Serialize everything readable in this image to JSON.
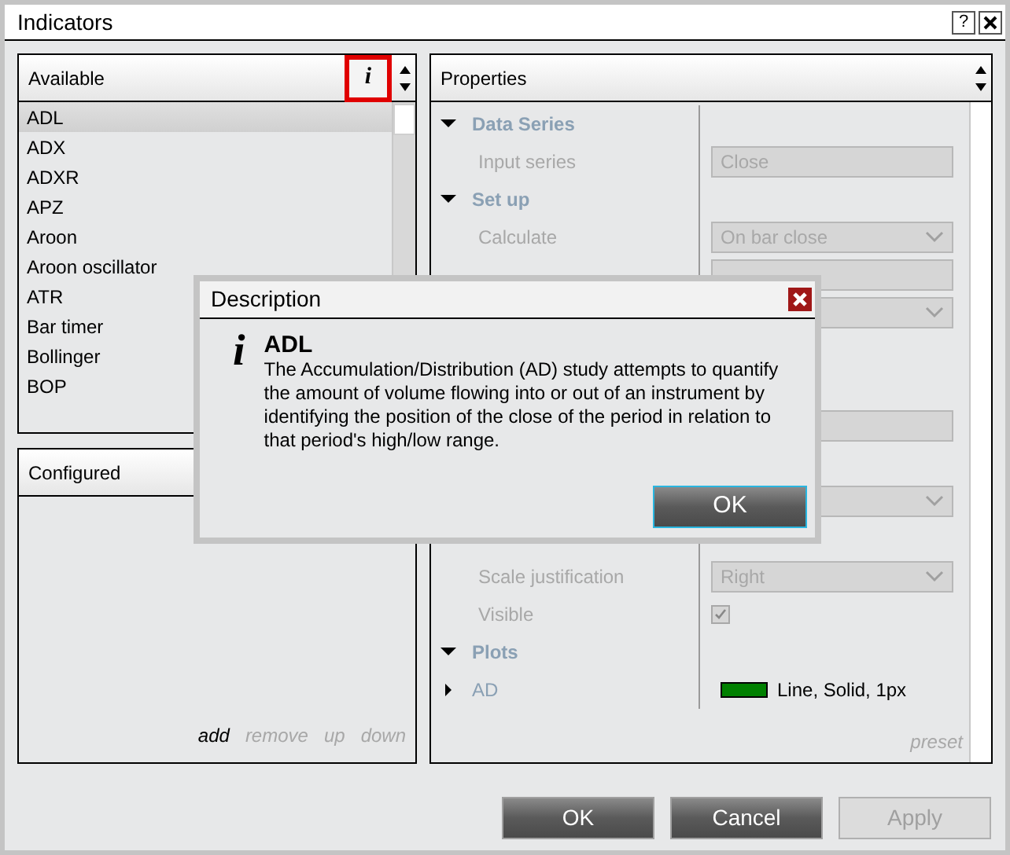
{
  "window": {
    "title": "Indicators",
    "help": "?"
  },
  "available": {
    "title": "Available",
    "info": "i",
    "items": [
      {
        "label": "ADL",
        "selected": true
      },
      {
        "label": "ADX",
        "selected": false
      },
      {
        "label": "ADXR",
        "selected": false
      },
      {
        "label": "APZ",
        "selected": false
      },
      {
        "label": "Aroon",
        "selected": false
      },
      {
        "label": "Aroon oscillator",
        "selected": false
      },
      {
        "label": "ATR",
        "selected": false
      },
      {
        "label": "Bar timer",
        "selected": false
      },
      {
        "label": "Bollinger",
        "selected": false
      },
      {
        "label": "BOP",
        "selected": false
      }
    ]
  },
  "configured": {
    "title": "Configured",
    "actions": [
      {
        "label": "add",
        "disabled": false
      },
      {
        "label": "remove",
        "disabled": true
      },
      {
        "label": "up",
        "disabled": true
      },
      {
        "label": "down",
        "disabled": true
      }
    ]
  },
  "properties": {
    "title": "Properties",
    "preset": "preset",
    "rows": [
      {
        "kind": "category",
        "label": "Data Series",
        "expanded": true
      },
      {
        "kind": "field",
        "label": "Input series",
        "value": "Close"
      },
      {
        "kind": "category",
        "label": "Set up",
        "expanded": true
      },
      {
        "kind": "dropdown",
        "label": "Calculate",
        "value": "On bar close"
      },
      {
        "kind": "field"
      },
      {
        "kind": "dropdown"
      },
      {
        "kind": "blank"
      },
      {
        "kind": "blank"
      },
      {
        "kind": "field"
      },
      {
        "kind": "blank"
      },
      {
        "kind": "dropdown"
      },
      {
        "kind": "blank"
      },
      {
        "kind": "dropdown",
        "label": "Scale justification",
        "value": "Right"
      },
      {
        "kind": "checkbox",
        "label": "Visible",
        "checked": true
      },
      {
        "kind": "category",
        "label": "Plots",
        "expanded": true
      },
      {
        "kind": "plot",
        "label": "AD",
        "expanded": false,
        "color": "#008000",
        "value": "Line, Solid, 1px"
      }
    ]
  },
  "buttons": [
    {
      "label": "OK",
      "disabled": false
    },
    {
      "label": "Cancel",
      "disabled": false
    },
    {
      "label": "Apply",
      "disabled": true
    }
  ],
  "dialog": {
    "title": "Description",
    "icon": "i",
    "heading": "ADL",
    "text": "The Accumulation/Distribution (AD) study attempts to quantify the amount of volume flowing into or out of an instrument by identifying the position of the close of the period in relation to that period's high/low range.",
    "button": "OK"
  }
}
